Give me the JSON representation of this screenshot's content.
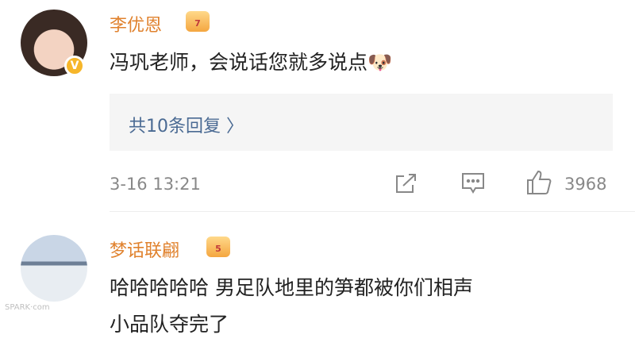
{
  "comments": [
    {
      "username": "李优恩",
      "text": "冯巩老师，会说话您就多说点",
      "emoji": "🐶",
      "badge_level": "7",
      "verified_mark": "V"
    },
    {
      "username": "梦话联翩",
      "text_line1": "哈哈哈哈哈 男足队地里的笋都被你们相声",
      "text_line2": "小品队夺完了",
      "badge_level": "5"
    }
  ],
  "reply_summary": "共10条回复 〉",
  "timestamp": "3-16 13:21",
  "like_count": "3968",
  "icons": [
    "share-icon",
    "comment-icon",
    "like-icon"
  ],
  "watermark": "SPARK·com",
  "colors": {
    "username": "#e0822e",
    "link": "#4a6a93",
    "meta": "#888888"
  }
}
